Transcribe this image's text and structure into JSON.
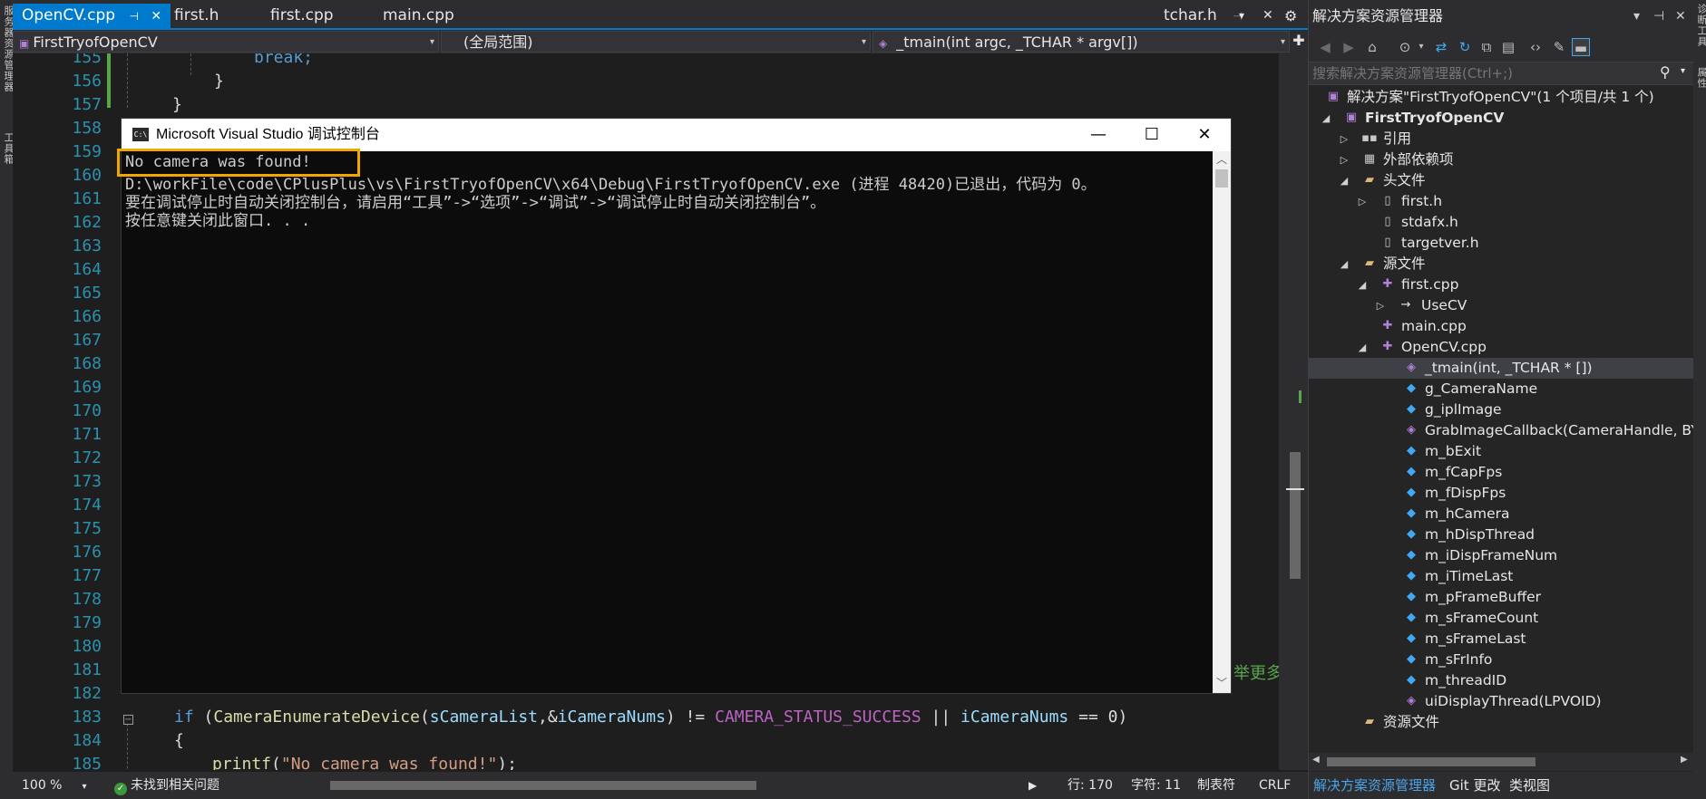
{
  "left_strip": {
    "labels": [
      "服务器资源管理器",
      "工具箱"
    ]
  },
  "right_strip": {
    "labels": [
      "诊断工具",
      "属性"
    ]
  },
  "tabs": {
    "items": [
      {
        "label": "OpenCV.cpp",
        "active": true
      },
      {
        "label": "first.h"
      },
      {
        "label": "first.cpp"
      },
      {
        "label": "main.cpp"
      }
    ],
    "right_label": "tchar.h",
    "pin_glyph": "⊣",
    "close_glyph": "✕",
    "gear_glyph": "⚙"
  },
  "navbar": {
    "project": "FirstTryofOpenCV",
    "scope": "(全局范围)",
    "function": "_tmain(int argc, _TCHAR * argv[])"
  },
  "code": {
    "line_numbers": [
      "155",
      "156",
      "157",
      "158",
      "159",
      "160",
      "161",
      "162",
      "163",
      "164",
      "165",
      "166",
      "167",
      "168",
      "169",
      "170",
      "171",
      "172",
      "173",
      "174",
      "175",
      "176",
      "177",
      "178",
      "179",
      "180",
      "181",
      "182",
      "183",
      "184",
      "185"
    ],
    "line_155": "break;",
    "line_156": "}",
    "line_157": "}",
    "line_181_partial": "举更多",
    "line_183": {
      "kw_if": "if",
      "paren_open": " (",
      "fn": "CameraEnumerateDevice",
      "p1": "(",
      "arg1": "sCameraList",
      "comma": ",&",
      "arg2": "iCameraNums",
      "op1": ") != ",
      "macro": "CAMERA_STATUS_SUCCESS",
      "op2": " || ",
      "var2": "iCameraNums",
      "op3": " == 0)"
    },
    "line_184": "{",
    "line_185": {
      "fn": "printf",
      "p": "(",
      "str": "\"No camera was found!\"",
      "end": ");"
    }
  },
  "status": {
    "zoom": "100 %",
    "issues": "未找到相关问题",
    "line": "行: 170",
    "col": "字符: 11",
    "tabs": "制表符",
    "eol": "CRLF"
  },
  "console": {
    "title": "Microsoft Visual Studio 调试控制台",
    "icon_text": "C:\\",
    "minimize": "—",
    "maximize": "☐",
    "close": "✕",
    "lines": [
      "No camera was found!",
      "D:\\workFile\\code\\CPlusPlus\\vs\\FirstTryofOpenCV\\x64\\Debug\\FirstTryofOpenCV.exe (进程 48420)已退出，代码为 0。",
      "要在调试停止时自动关闭控制台，请启用“工具”->“选项”->“调试”->“调试停止时自动关闭控制台”。",
      "按任意键关闭此窗口. . ."
    ],
    "scroll_up": "︿",
    "scroll_down": "﹀"
  },
  "solution_explorer": {
    "title": "解决方案资源管理器",
    "search_placeholder": "搜索解决方案资源管理器(Ctrl+;)",
    "tree": [
      {
        "label": "解决方案\"FirstTryofOpenCV\"(1 个项目/共 1 个)",
        "icon": "solution-icon",
        "bold": false
      },
      {
        "label": "FirstTryofOpenCV",
        "icon": "project-icon",
        "bold": true
      },
      {
        "label": "引用",
        "icon": "references-icon"
      },
      {
        "label": "外部依赖项",
        "icon": "external-deps-icon"
      },
      {
        "label": "头文件",
        "icon": "folder-icon"
      },
      {
        "label": "first.h",
        "icon": "header-file-icon"
      },
      {
        "label": "stdafx.h",
        "icon": "header-file-icon"
      },
      {
        "label": "targetver.h",
        "icon": "header-file-icon"
      },
      {
        "label": "源文件",
        "icon": "folder-icon"
      },
      {
        "label": "first.cpp",
        "icon": "cpp-file-icon"
      },
      {
        "label": "UseCV",
        "icon": "arrow-icon"
      },
      {
        "label": "main.cpp",
        "icon": "cpp-file-icon"
      },
      {
        "label": "OpenCV.cpp",
        "icon": "cpp-file-icon"
      },
      {
        "label": "_tmain(int, _TCHAR * [])",
        "icon": "function-icon",
        "selected": true
      },
      {
        "label": "g_CameraName",
        "icon": "field-icon"
      },
      {
        "label": "g_iplImage",
        "icon": "field-icon"
      },
      {
        "label": "GrabImageCallback(CameraHandle, BYT",
        "icon": "function-icon"
      },
      {
        "label": "m_bExit",
        "icon": "field-icon"
      },
      {
        "label": "m_fCapFps",
        "icon": "field-icon"
      },
      {
        "label": "m_fDispFps",
        "icon": "field-icon"
      },
      {
        "label": "m_hCamera",
        "icon": "field-icon"
      },
      {
        "label": "m_hDispThread",
        "icon": "field-icon"
      },
      {
        "label": "m_iDispFrameNum",
        "icon": "field-icon"
      },
      {
        "label": "m_iTimeLast",
        "icon": "field-icon"
      },
      {
        "label": "m_pFrameBuffer",
        "icon": "field-icon"
      },
      {
        "label": "m_sFrameCount",
        "icon": "field-icon"
      },
      {
        "label": "m_sFrameLast",
        "icon": "field-icon"
      },
      {
        "label": "m_sFrInfo",
        "icon": "field-icon"
      },
      {
        "label": "m_threadID",
        "icon": "field-icon"
      },
      {
        "label": "uiDisplayThread(LPVOID)",
        "icon": "function-icon"
      },
      {
        "label": "资源文件",
        "icon": "folder-icon"
      }
    ],
    "bottom_tabs": [
      "解决方案资源管理器",
      "Git 更改",
      "类视图"
    ]
  },
  "colors": {
    "accent": "#007acc",
    "highlight_box": "#f0a800",
    "field_icon": "#3fa9f5",
    "function_icon": "#b180d7"
  }
}
